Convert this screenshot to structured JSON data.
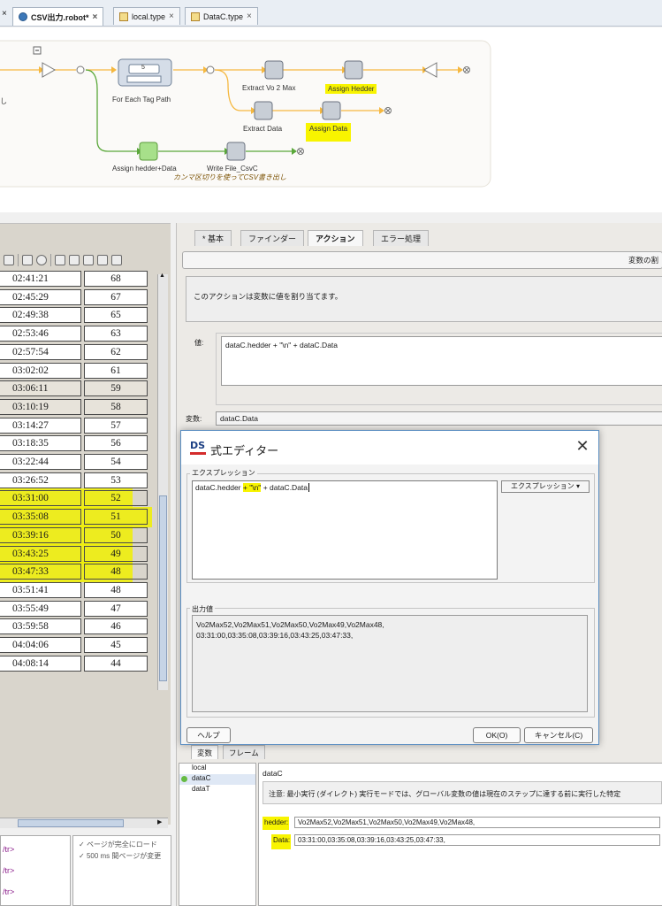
{
  "tabs": [
    {
      "label": "CSV出力.robot*",
      "active": true
    },
    {
      "label": "local.type",
      "active": false
    },
    {
      "label": "DataC.type",
      "active": false
    }
  ],
  "flow": {
    "left_cut_text": "し",
    "for_each_counter": "5",
    "for_each_label": "For Each Tag Path",
    "nodes": {
      "extract_vo2max": "Extract Vo 2 Max",
      "assign_hedder": "Assign Hedder",
      "extract_data": "Extract Data",
      "assign_data": "Assign Data",
      "assign_hedder_data": "Assign hedder+Data",
      "write_file": "Write File_CsvC"
    },
    "write_note": "カンマ区切りを使ってCSV書き出し"
  },
  "table": {
    "rows": [
      {
        "time": "02:41:21",
        "value": "68",
        "dim": false,
        "mark": false
      },
      {
        "time": "02:45:29",
        "value": "67",
        "dim": false,
        "mark": false
      },
      {
        "time": "02:49:38",
        "value": "65",
        "dim": false,
        "mark": false
      },
      {
        "time": "02:53:46",
        "value": "63",
        "dim": false,
        "mark": false
      },
      {
        "time": "02:57:54",
        "value": "62",
        "dim": false,
        "mark": false
      },
      {
        "time": "03:02:02",
        "value": "61",
        "dim": false,
        "mark": false
      },
      {
        "time": "03:06:11",
        "value": "59",
        "dim": true,
        "mark": false
      },
      {
        "time": "03:10:19",
        "value": "58",
        "dim": true,
        "mark": false
      },
      {
        "time": "03:14:27",
        "value": "57",
        "dim": false,
        "mark": false
      },
      {
        "time": "03:18:35",
        "value": "56",
        "dim": false,
        "mark": false
      },
      {
        "time": "03:22:44",
        "value": "54",
        "dim": false,
        "mark": false
      },
      {
        "time": "03:26:52",
        "value": "53",
        "dim": false,
        "mark": false
      },
      {
        "time": "03:31:00",
        "value": "52",
        "dim": false,
        "mark": true
      },
      {
        "time": "03:35:08",
        "value": "51",
        "dim": false,
        "mark": true
      },
      {
        "time": "03:39:16",
        "value": "50",
        "dim": false,
        "mark": true
      },
      {
        "time": "03:43:25",
        "value": "49",
        "dim": false,
        "mark": true
      },
      {
        "time": "03:47:33",
        "value": "48",
        "dim": false,
        "mark": true
      },
      {
        "time": "03:51:41",
        "value": "48",
        "dim": false,
        "mark": false
      },
      {
        "time": "03:55:49",
        "value": "47",
        "dim": false,
        "mark": false
      },
      {
        "time": "03:59:58",
        "value": "46",
        "dim": false,
        "mark": false
      },
      {
        "time": "04:04:06",
        "value": "45",
        "dim": false,
        "mark": false
      },
      {
        "time": "04:08:14",
        "value": "44",
        "dim": false,
        "mark": false
      }
    ]
  },
  "source_lines": [
    "/tr>",
    "/tr>",
    "/tr>"
  ],
  "log": [
    "ページが完全にロード",
    "500 ms 間ページが変更"
  ],
  "props": {
    "tabs": [
      "* 基本",
      "ファインダー",
      "アクション",
      "エラー処理"
    ],
    "active_tab": "アクション",
    "title": "変数の割",
    "description": "このアクションは変数に値を割り当てます。",
    "value_label": "値:",
    "value": "dataC.hedder + \"\\n\" + dataC.Data",
    "var_label": "変数:",
    "var_value": "dataC.Data"
  },
  "bottom": {
    "tabs": [
      "変数",
      "フレーム"
    ],
    "var_list": [
      "local",
      "dataC",
      "dataT"
    ],
    "selected_var": "dataC",
    "detail_name": "dataC",
    "note": "注意: 最小実行 (ダイレクト) 実行モードでは、グローバル変数の値は現在のステップに達する前に実行した特定",
    "fields": [
      {
        "label": "hedder:",
        "value": "Vo2Max52,Vo2Max51,Vo2Max50,Vo2Max49,Vo2Max48,"
      },
      {
        "label": "Data:",
        "value": "03:31:00,03:35:08,03:39:16,03:43:25,03:47:33,"
      }
    ]
  },
  "dialog": {
    "logo": "DS",
    "title": "式エディター",
    "expr_group_label": "エクスプレッション",
    "expr_text_a": "dataC.hedder ",
    "expr_text_hl": "+ \"\\n\"",
    "expr_text_b": " + dataC.Data",
    "expr_button": "エクスプレッション ▾",
    "output_group_label": "出力値",
    "output_line1": "Vo2Max52,Vo2Max51,Vo2Max50,Vo2Max49,Vo2Max48,",
    "output_line2": "03:31:00,03:35:08,03:39:16,03:43:25,03:47:33,",
    "help_button": "ヘルプ",
    "ok_button": "OK(O)",
    "cancel_button": "キャンセル(C)"
  },
  "colors": {
    "highlight": "#f8f400",
    "flow_line": "#f5b840",
    "green_line": "#5aa83a",
    "dialog_border": "#5d8fc2"
  }
}
